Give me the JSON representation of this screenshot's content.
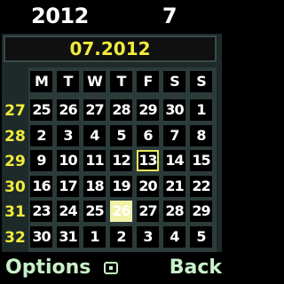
{
  "header": {
    "year": "2012",
    "week": "7"
  },
  "month_label": "07.2012",
  "days_of_week": [
    "M",
    "T",
    "W",
    "T",
    "F",
    "S",
    "S"
  ],
  "week_numbers": [
    "27",
    "28",
    "29",
    "30",
    "31",
    "32"
  ],
  "weeks": [
    [
      "25",
      "26",
      "27",
      "28",
      "29",
      "30",
      "1"
    ],
    [
      "2",
      "3",
      "4",
      "5",
      "6",
      "7",
      "8"
    ],
    [
      "9",
      "10",
      "11",
      "12",
      "13",
      "14",
      "15"
    ],
    [
      "16",
      "17",
      "18",
      "19",
      "20",
      "21",
      "22"
    ],
    [
      "23",
      "24",
      "25",
      "26",
      "27",
      "28",
      "29"
    ],
    [
      "30",
      "31",
      "1",
      "2",
      "3",
      "4",
      "5"
    ]
  ],
  "selected_day": "13",
  "today_day": "26",
  "softkeys": {
    "left": "Options",
    "right": "Back",
    "center_icon": "menu-square-icon"
  },
  "colors": {
    "accent_yellow": "#f0ec3c",
    "softkey_green": "#c9f1c9",
    "today_highlight": "#f1f1a8"
  }
}
